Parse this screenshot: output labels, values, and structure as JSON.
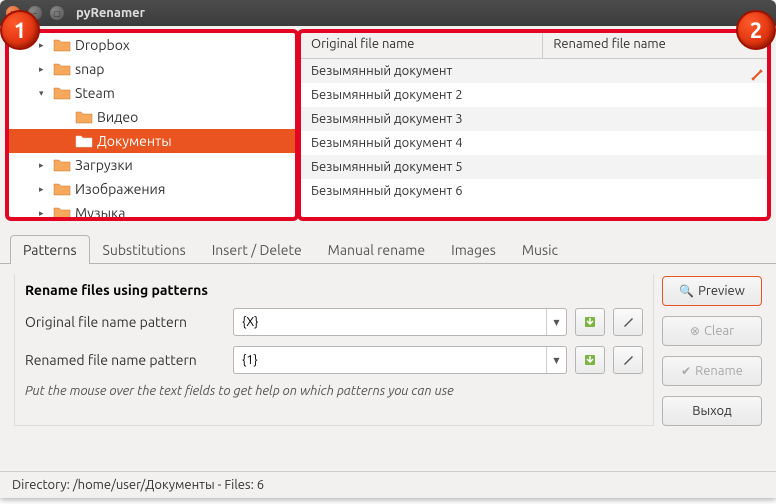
{
  "window": {
    "title": "pyRenamer"
  },
  "annotation": {
    "n1": "1",
    "n2": "2"
  },
  "tree": {
    "items": [
      {
        "label": "Dropbox",
        "indent": 1,
        "expander": "▸"
      },
      {
        "label": "snap",
        "indent": 1,
        "expander": "▸"
      },
      {
        "label": "Steam",
        "indent": 1,
        "expander": "▾"
      },
      {
        "label": "Видео",
        "indent": 2,
        "expander": ""
      },
      {
        "label": "Документы",
        "indent": 2,
        "expander": "",
        "selected": true
      },
      {
        "label": "Загрузки",
        "indent": 1,
        "expander": "▸"
      },
      {
        "label": "Изображения",
        "indent": 1,
        "expander": "▸"
      },
      {
        "label": "Музыка",
        "indent": 1,
        "expander": "▸"
      }
    ]
  },
  "files": {
    "col_original": "Original file name",
    "col_renamed": "Renamed file name",
    "rows": [
      {
        "orig": "Безымянный документ",
        "ren": ""
      },
      {
        "orig": "Безымянный документ 2",
        "ren": ""
      },
      {
        "orig": "Безымянный документ 3",
        "ren": ""
      },
      {
        "orig": "Безымянный документ 4",
        "ren": ""
      },
      {
        "orig": "Безымянный документ 5",
        "ren": ""
      },
      {
        "orig": "Безымянный документ 6",
        "ren": ""
      }
    ]
  },
  "tabs": {
    "patterns": "Patterns",
    "substitutions": "Substitutions",
    "insert_delete": "Insert / Delete",
    "manual": "Manual rename",
    "images": "Images",
    "music": "Music"
  },
  "patterns": {
    "title": "Rename files using patterns",
    "orig_label": "Original file name pattern",
    "orig_value": "{X}",
    "ren_label": "Renamed file name pattern",
    "ren_value": "{1}",
    "hint": "Put the mouse over the text fields to get help on which patterns you can use"
  },
  "buttons": {
    "preview": "Preview",
    "clear": "Clear",
    "rename": "Rename",
    "exit": "Выход"
  },
  "status": "Directory: /home/user/Документы - Files: 6"
}
